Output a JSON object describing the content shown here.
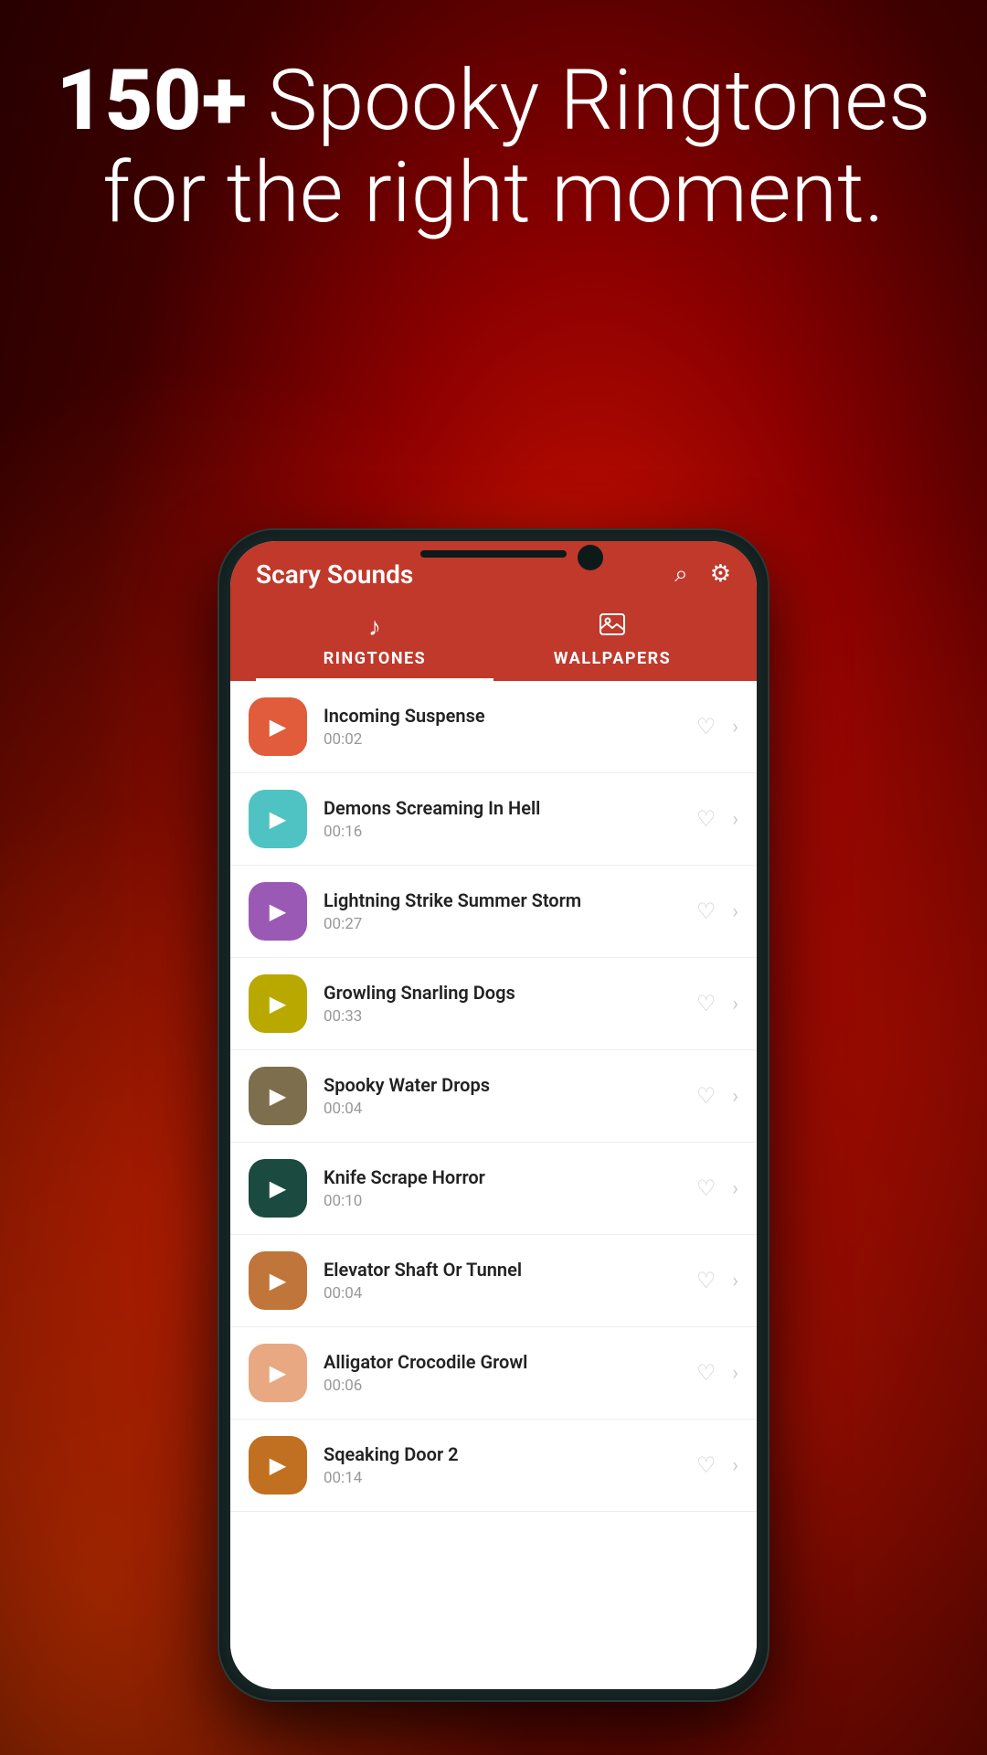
{
  "hero": {
    "line1_bold": "150+",
    "line1_rest": " Spooky Ringtones",
    "line2": "for the right moment."
  },
  "app": {
    "title": "Scary Sounds",
    "tabs": [
      {
        "id": "ringtones",
        "label": "RINGTONES",
        "icon": "♪",
        "active": true
      },
      {
        "id": "wallpapers",
        "label": "WALLPAPERS",
        "icon": "🖼",
        "active": false
      }
    ],
    "ringtones": [
      {
        "name": "Incoming Suspense",
        "duration": "00:02",
        "color": "#e05c3a",
        "id": 1
      },
      {
        "name": "Demons Screaming In Hell",
        "duration": "00:16",
        "color": "#4fc3c3",
        "id": 2
      },
      {
        "name": "Lightning Strike Summer Storm",
        "duration": "00:27",
        "color": "#9b59b6",
        "id": 3
      },
      {
        "name": "Growling Snarling Dogs",
        "duration": "00:33",
        "color": "#b8a800",
        "id": 4
      },
      {
        "name": "Spooky Water Drops",
        "duration": "00:04",
        "color": "#7d6e4e",
        "id": 5
      },
      {
        "name": "Knife Scrape Horror",
        "duration": "00:10",
        "color": "#1a4a40",
        "id": 6
      },
      {
        "name": "Elevator Shaft Or Tunnel",
        "duration": "00:04",
        "color": "#c0753a",
        "id": 7
      },
      {
        "name": "Alligator Crocodile Growl",
        "duration": "00:06",
        "color": "#e8a882",
        "id": 8
      },
      {
        "name": "Sqeaking Door 2",
        "duration": "00:14",
        "color": "#c07020",
        "id": 9
      }
    ]
  }
}
